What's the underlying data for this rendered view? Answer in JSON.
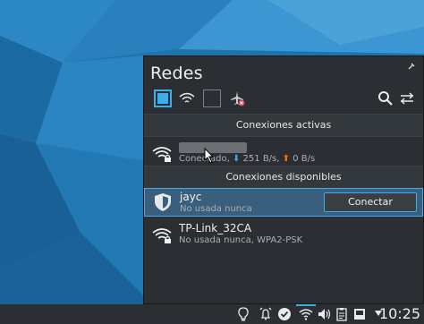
{
  "popup": {
    "title": "Redes",
    "sections": {
      "active": "Conexiones activas",
      "available": "Conexiones disponibles"
    },
    "active_connection": {
      "status_prefix": "Conectado, ",
      "download": "251 B/s",
      "upload": "0 B/s"
    },
    "available_connections": [
      {
        "name": "jayc",
        "status": "No usada nunca",
        "button": "Conectar"
      },
      {
        "name": "TP-Link_32CA",
        "status": "No usada nunca, WPA2-PSK"
      }
    ]
  },
  "taskbar": {
    "clock": "10:25"
  },
  "colors": {
    "accent": "#3daee9",
    "upload": "#f67400",
    "panel": "#2b2f34"
  },
  "icons": [
    "pin-icon",
    "checkbox-checked-icon",
    "wifi-icon",
    "checkbox-icon",
    "airplane-icon",
    "search-icon",
    "settings-icon",
    "lightbulb-icon",
    "alarm-icon",
    "check-icon",
    "volume-icon",
    "clipboard-icon",
    "device-icon",
    "tray-arrow-icon"
  ]
}
